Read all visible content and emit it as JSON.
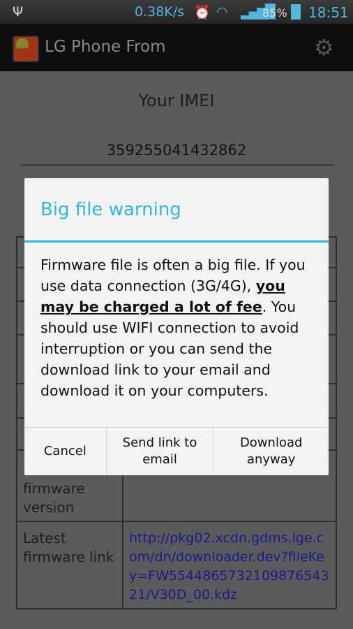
{
  "status_bar": {
    "usb_icon": "usb-icon",
    "speed": "0.38K/s",
    "battery": "85%",
    "time": "18:51"
  },
  "action_bar": {
    "title": "LG Phone From",
    "settings_icon": "gear-icon"
  },
  "main": {
    "imei_label": "Your IMEI",
    "imei": "359255041432862",
    "table": [
      {
        "label": "",
        "value": ""
      },
      {
        "label": "",
        "value": ""
      },
      {
        "label": "",
        "value": ""
      },
      {
        "label": "",
        "value": ""
      },
      {
        "label": "",
        "value": ""
      },
      {
        "label": "",
        "value": ""
      },
      {
        "label": "Latest firmware version",
        "value": ""
      },
      {
        "label": "Latest firmware link",
        "value": "http://pkg02.xcdn.gdms.lge.com/dn/downloader.dev?fileKey=FW554486573210987654321/V30D_00.kdz"
      }
    ]
  },
  "dialog": {
    "title": "Big file warning",
    "body_before": "Firmware file is often a big file. If you use data connection (3G/4G), ",
    "body_bold": "you may be charged a lot of fee",
    "body_after": ". You should use WIFI connection to avoid interruption or you can send the download link to your email and download it on your computers.",
    "buttons": [
      "Cancel",
      "Send link to email",
      "Download anyway"
    ],
    "accent": "#33b5e5"
  }
}
